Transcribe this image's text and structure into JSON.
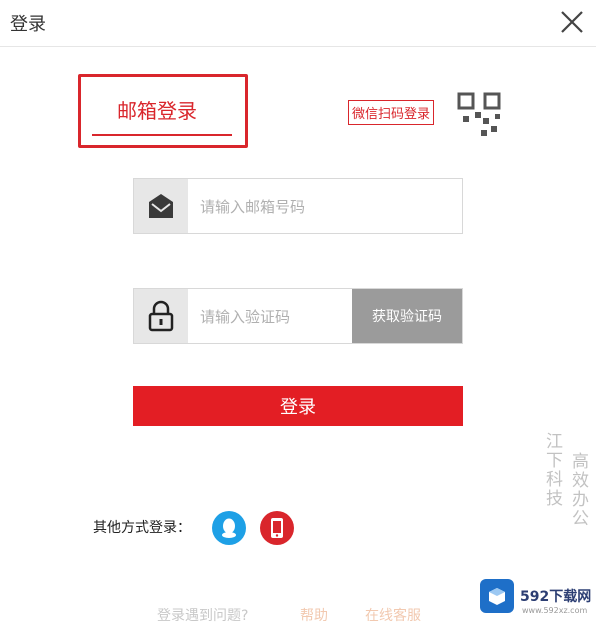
{
  "header": {
    "title": "登录"
  },
  "tabs": {
    "email_login": "邮箱登录"
  },
  "qr": {
    "label": "微信扫码登录"
  },
  "email": {
    "placeholder": "请输入邮箱号码"
  },
  "code": {
    "placeholder": "请输入验证码",
    "button": "获取验证码"
  },
  "submit": {
    "label": "登录"
  },
  "other": {
    "label": "其他方式登录："
  },
  "help": {
    "text": "登录遇到问题?",
    "link1": "帮助",
    "link2": "在线客服"
  },
  "watermark": {
    "col1": "江下科技",
    "col2": "高效办公"
  },
  "badge": {
    "brand": "592下载网",
    "site": "www.592xz.com"
  },
  "colors": {
    "accent": "#e31e24",
    "qq": "#1ea0e6",
    "gray_button": "#9b9b9b"
  }
}
